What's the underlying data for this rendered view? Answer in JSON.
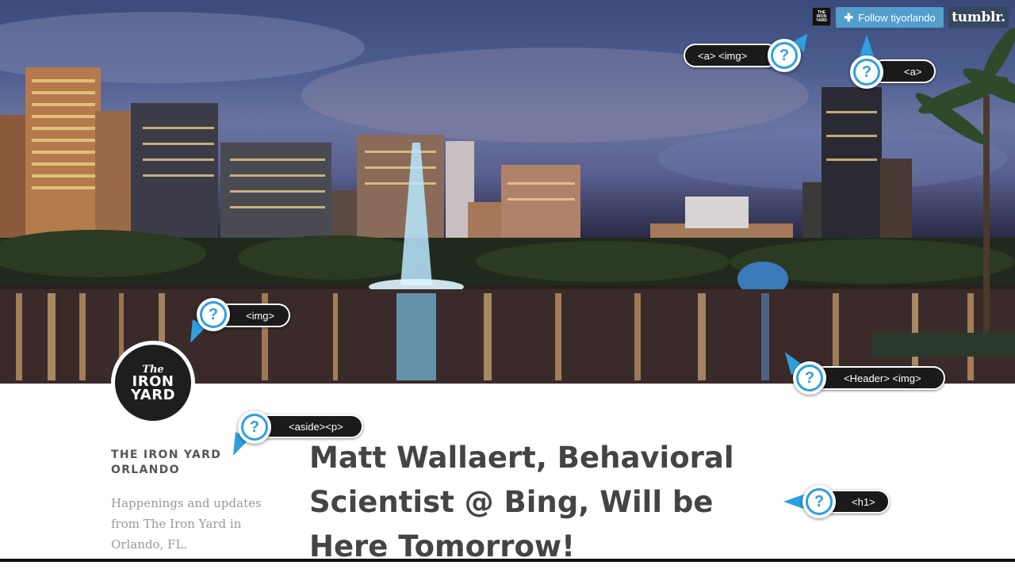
{
  "header": {
    "follow_label": "Follow tiyorlando",
    "follow_plus": "✚",
    "tumblr_label": "tumblr.",
    "mini_logo_lines": [
      "THE",
      "IRON",
      "YARD"
    ]
  },
  "avatar": {
    "line1": "The",
    "line2": "IRON",
    "line3": "YARD"
  },
  "sidebar": {
    "title": "THE IRON YARD ORLANDO",
    "description": "Happenings and updates from The Iron Yard in Orlando, FL."
  },
  "post": {
    "title": "Matt Wallaert, Behavioral Scientist @ Bing, Will be Here Tomorrow!"
  },
  "annotations": {
    "a_img": "<a> <img>",
    "a": "<a>",
    "img": "<img>",
    "header_img": "<Header> <img>",
    "aside_p": "<aside><p>",
    "h1": "<h1>",
    "question": "?"
  },
  "colors": {
    "follow_bg": "#529ecc",
    "tumblr_bg": "#36465d",
    "callout_blue": "#2f9fe0",
    "title_text": "#444444"
  }
}
